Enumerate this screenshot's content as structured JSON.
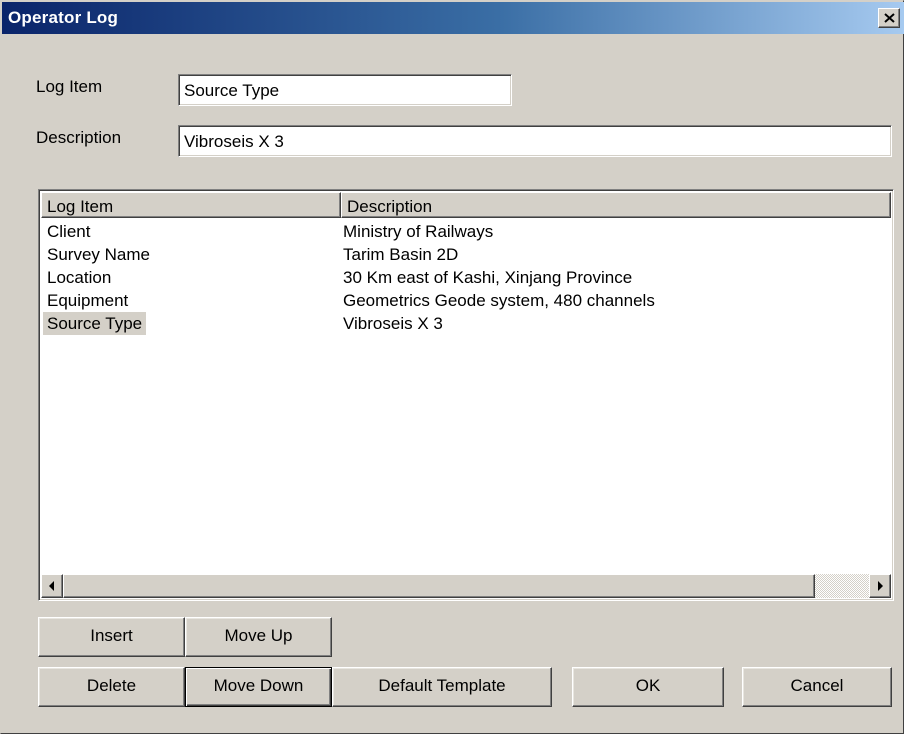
{
  "window": {
    "title": "Operator Log"
  },
  "form": {
    "log_item_label": "Log Item",
    "log_item_value": "Source Type",
    "description_label": "Description",
    "description_value": "Vibroseis X 3"
  },
  "list": {
    "columns": [
      "Log Item",
      "Description"
    ],
    "rows": [
      {
        "item": "Client",
        "description": "Ministry of Railways"
      },
      {
        "item": "Survey Name",
        "description": "Tarim Basin 2D"
      },
      {
        "item": "Location",
        "description": "30 Km east of Kashi, Xinjang Province"
      },
      {
        "item": "Equipment",
        "description": "Geometrics Geode system, 480 channels"
      },
      {
        "item": "Source Type",
        "description": "Vibroseis X 3"
      }
    ],
    "selected_row": 4
  },
  "buttons": {
    "insert": "Insert",
    "move_up": "Move Up",
    "delete": "Delete",
    "move_down": "Move Down",
    "default_template": "Default Template",
    "ok": "OK",
    "cancel": "Cancel"
  },
  "icons": {
    "close": "close-icon",
    "scroll_left": "arrow-left-icon",
    "scroll_right": "arrow-right-icon"
  },
  "colors": {
    "title_start": "#0a246a",
    "title_end": "#a6caf0",
    "face": "#d4d0c8",
    "selection": "#d4d0c8"
  }
}
